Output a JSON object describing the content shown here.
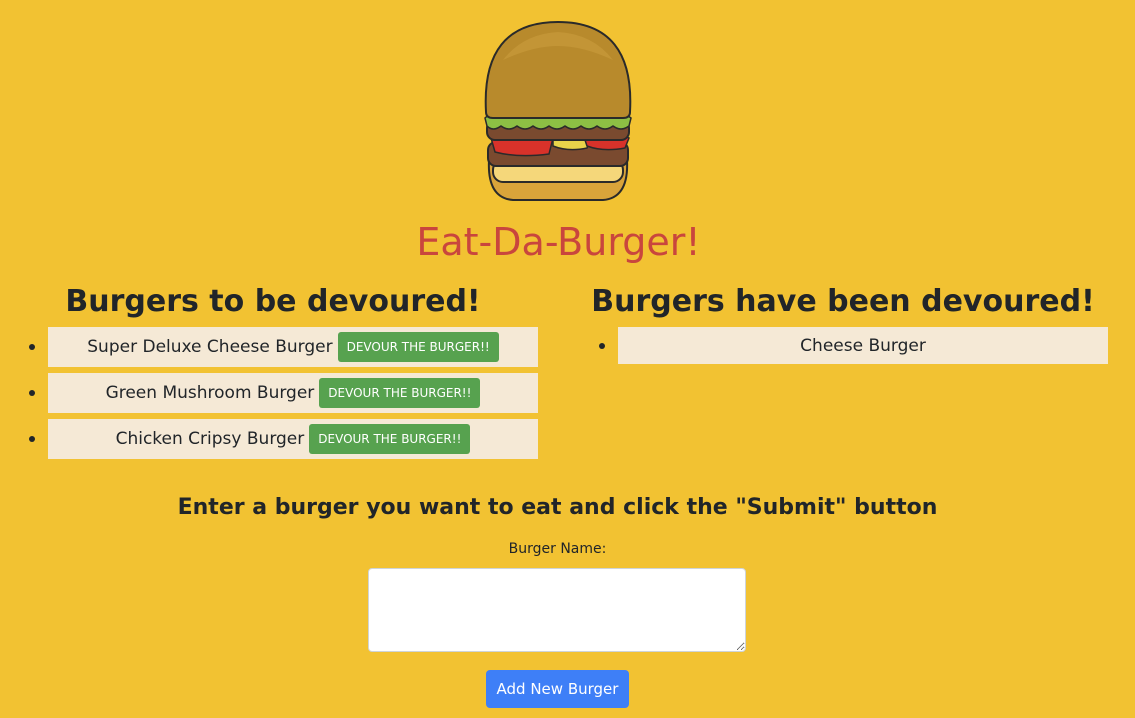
{
  "header": {
    "logo_icon": "hamburger-icon",
    "title": "Eat-Da-Burger!"
  },
  "to_devour": {
    "heading": "Burgers to be devoured!",
    "items": [
      {
        "name": "Super Deluxe Cheese Burger",
        "button": "DEVOUR THE BURGER!!"
      },
      {
        "name": "Green Mushroom Burger",
        "button": "DEVOUR THE BURGER!!"
      },
      {
        "name": "Chicken Cripsy Burger",
        "button": "DEVOUR THE BURGER!!"
      }
    ]
  },
  "devoured": {
    "heading": "Burgers have been devoured!",
    "items": [
      {
        "name": "Cheese Burger"
      }
    ]
  },
  "form": {
    "prompt": "Enter a burger you want to eat and click the \"Submit\" button",
    "label": "Burger Name:",
    "input_value": "",
    "submit_label": "Add New Burger"
  },
  "colors": {
    "background": "#F2C232",
    "title": "#C9463D",
    "devour_button": "#57A24F",
    "submit_button": "#3E7FF7",
    "list_item": "#F5E9D6"
  }
}
